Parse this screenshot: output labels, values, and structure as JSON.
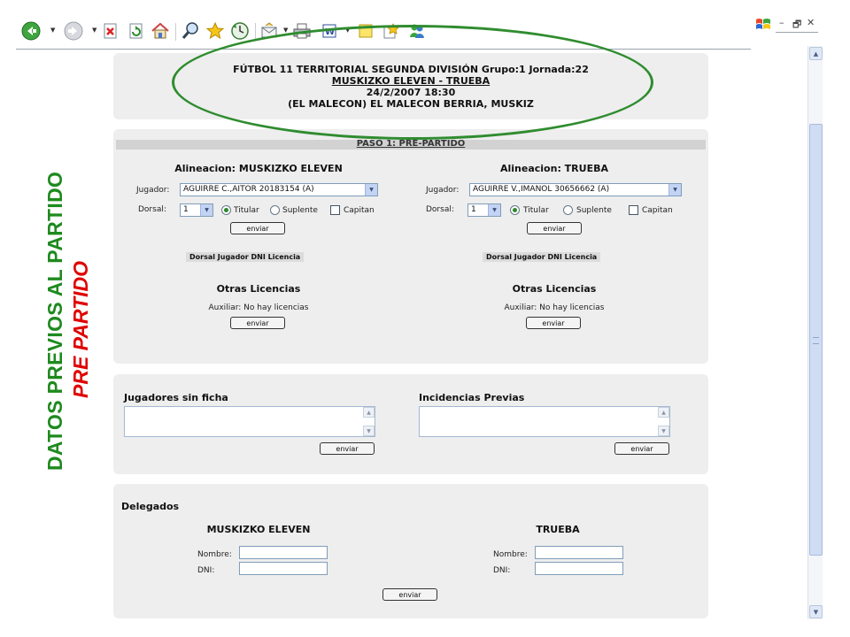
{
  "window": {
    "minimize": "–",
    "restore": "🗗",
    "close": "✕"
  },
  "caption": {
    "line1": "DATOS  PREVIOS AL PARTIDO",
    "line2": "PRE PARTIDO"
  },
  "match": {
    "line1": "FÚTBOL 11 TERRITORIAL SEGUNDA DIVISIÓN Grupo:1 Jornada:22",
    "line2": "MUSKIZKO ELEVEN  - TRUEBA",
    "line3": "24/2/2007 18:30",
    "line4": "(EL MALECON) EL MALECON BERRIA, MUSKIZ"
  },
  "paso": "PASO 1: PRE-PARTIDO",
  "home": {
    "title": "Alineacion: MUSKIZKO ELEVEN",
    "jugador_label": "Jugador:",
    "jugador_value": "AGUIRRE C.,AITOR 20183154 (A)",
    "dorsal_label": "Dorsal:",
    "dorsal_value": "1",
    "titular": "Titular",
    "suplente": "Suplente",
    "capitan": "Capitan",
    "enviar": "enviar",
    "table_header": "Dorsal Jugador DNI Licencia",
    "otras": "Otras Licencias",
    "auxiliar": "Auxiliar:  No hay licencias",
    "enviar2": "enviar"
  },
  "away": {
    "title": "Alineacion: TRUEBA",
    "jugador_label": "Jugador:",
    "jugador_value": "AGUIRRE V.,IMANOL 30656662 (A)",
    "dorsal_label": "Dorsal:",
    "dorsal_value": "1",
    "titular": "Titular",
    "suplente": "Suplente",
    "capitan": "Capitan",
    "enviar": "enviar",
    "table_header": "Dorsal Jugador DNI Licencia",
    "otras": "Otras Licencias",
    "auxiliar": "Auxiliar:  No hay licencias",
    "enviar2": "enviar"
  },
  "sin_ficha": {
    "title": "Jugadores sin ficha",
    "enviar": "enviar"
  },
  "incidencias": {
    "title": "Incidencias Previas",
    "enviar": "enviar"
  },
  "delegados": {
    "title": "Delegados",
    "home_team": "MUSKIZKO ELEVEN",
    "away_team": "TRUEBA",
    "nombre_label": "Nombre:",
    "dni_label": "DNI:",
    "enviar": "enviar"
  },
  "colors": {
    "caption_green": "#1e8a1e",
    "caption_red": "#e00000",
    "ellipse": "#2f8c2f",
    "panel": "#eeeeee"
  }
}
